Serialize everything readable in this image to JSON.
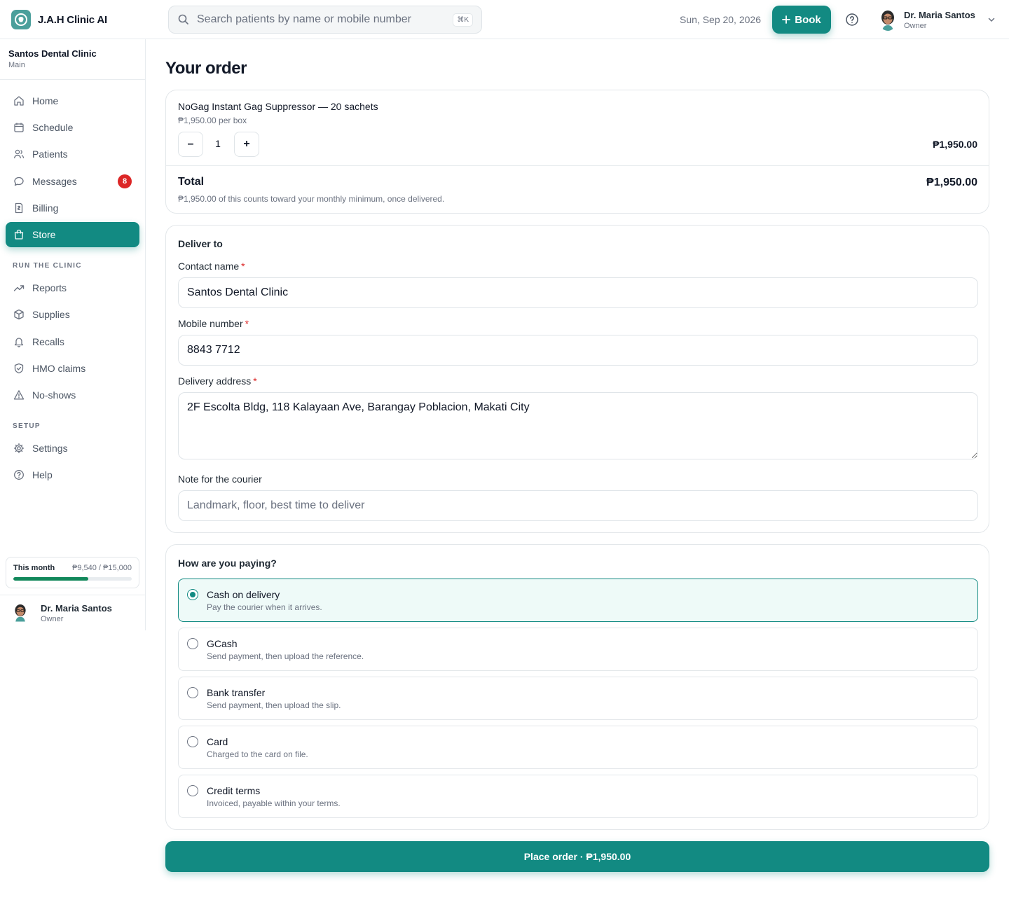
{
  "app": {
    "name": "J.A.H Clinic AI"
  },
  "search": {
    "placeholder": "Search patients by name or mobile number",
    "shortcut": "⌘K"
  },
  "header": {
    "date": "Sun, Sep 20, 2026",
    "book_label": "Book"
  },
  "user": {
    "name": "Dr. Maria Santos",
    "role": "Owner"
  },
  "clinic": {
    "name": "Santos Dental Clinic",
    "branch": "Main"
  },
  "nav": {
    "items": [
      {
        "label": "Home",
        "icon": "home-icon"
      },
      {
        "label": "Schedule",
        "icon": "calendar-icon"
      },
      {
        "label": "Patients",
        "icon": "users-icon"
      },
      {
        "label": "Messages",
        "icon": "chat-icon",
        "badge": "8"
      },
      {
        "label": "Billing",
        "icon": "receipt-icon"
      },
      {
        "label": "Store",
        "icon": "shopping-bag-icon",
        "active": true
      }
    ],
    "section_run": "RUN THE CLINIC",
    "run_items": [
      {
        "label": "Reports",
        "icon": "trending-up-icon"
      },
      {
        "label": "Supplies",
        "icon": "box-icon"
      },
      {
        "label": "Recalls",
        "icon": "bell-icon"
      },
      {
        "label": "HMO claims",
        "icon": "shield-check-icon"
      },
      {
        "label": "No-shows",
        "icon": "warning-icon"
      }
    ],
    "section_setup": "SETUP",
    "setup_items": [
      {
        "label": "Settings",
        "icon": "gear-icon"
      },
      {
        "label": "Help",
        "icon": "help-circle-icon"
      }
    ]
  },
  "month": {
    "label": "This month",
    "value": "₱9,540 / ₱15,000",
    "progress": 0.636
  },
  "order": {
    "title": "Your order",
    "product_name": "NoGag Instant Gag Suppressor — 20 sachets",
    "unit_price": "₱1,950.00 per box",
    "quantity": "1",
    "minus": "–",
    "plus": "+",
    "line_total": "₱1,950.00",
    "total_label": "Total",
    "total_value": "₱1,950.00",
    "total_note": "₱1,950.00 of this counts toward your monthly minimum, once delivered."
  },
  "delivery": {
    "title": "Deliver to",
    "contact_label": "Contact name",
    "contact_value": "Santos Dental Clinic",
    "mobile_label": "Mobile number",
    "mobile_value": "8843 7712",
    "address_label": "Delivery address",
    "address_value": "2F Escolta Bldg, 118 Kalayaan Ave, Barangay Poblacion, Makati City",
    "note_label": "Note for the courier",
    "note_placeholder": "Landmark, floor, best time to deliver",
    "required_mark": "*"
  },
  "payment": {
    "title": "How are you paying?",
    "options": [
      {
        "title": "Cash on delivery",
        "desc": "Pay the courier when it arrives.",
        "selected": true
      },
      {
        "title": "GCash",
        "desc": "Send payment, then upload the reference."
      },
      {
        "title": "Bank transfer",
        "desc": "Send payment, then upload the slip."
      },
      {
        "title": "Card",
        "desc": "Charged to the card on file."
      },
      {
        "title": "Credit terms",
        "desc": "Invoiced, payable within your terms."
      }
    ]
  },
  "place_order": {
    "label": "Place order · ₱1,950.00"
  },
  "colors": {
    "accent": "#128a82",
    "badge": "#dc2626",
    "progress": "#12885b",
    "selected_bg": "#eefaf8"
  }
}
